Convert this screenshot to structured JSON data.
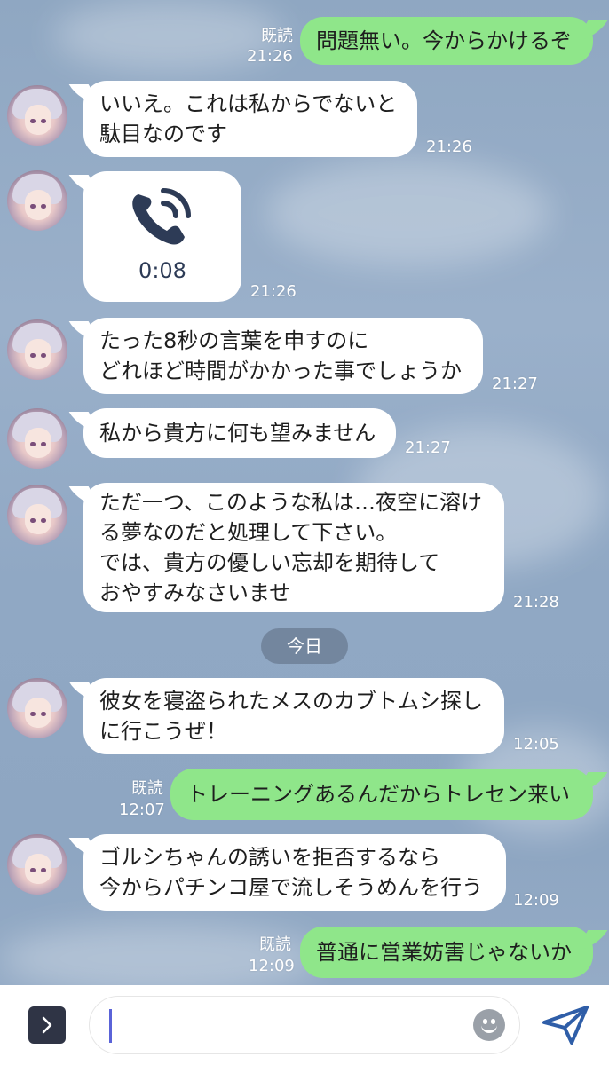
{
  "messages": [
    {
      "side": "out",
      "text": "問題無い。今からかけるぞ",
      "read": "既読",
      "time": "21:26"
    },
    {
      "side": "in",
      "text": "いいえ。これは私からでないと\n駄目なのです",
      "time": "21:26"
    },
    {
      "side": "in",
      "type": "call",
      "duration": "0:08",
      "time": "21:26"
    },
    {
      "side": "in",
      "text": "たった8秒の言葉を申すのに\nどれほど時間がかかった事でしょうか",
      "time": "21:27"
    },
    {
      "side": "in",
      "text": "私から貴方に何も望みません",
      "time": "21:27"
    },
    {
      "side": "in",
      "text": "ただ一つ、このような私は…夜空に溶け\nる夢なのだと処理して下さい。\nでは、貴方の優しい忘却を期待して\nおやすみなさいませ",
      "time": "21:28"
    },
    {
      "side": "in",
      "text": "彼女を寝盗られたメスのカブトムシ探し\nに行こうぜ！",
      "time": "12:05"
    },
    {
      "side": "out",
      "text": "トレーニングあるんだからトレセン来い",
      "read": "既読",
      "time": "12:07"
    },
    {
      "side": "in",
      "text": "ゴルシちゃんの誘いを拒否するなら\n今からパチンコ屋で流しそうめんを行う",
      "time": "12:09"
    },
    {
      "side": "out",
      "text": "普通に営業妨害じゃないか",
      "read": "既読",
      "time": "12:09"
    }
  ],
  "date_separator": "今日",
  "input": {
    "value": ""
  },
  "icons": {
    "expand": "chevron-right-icon",
    "emoji": "emoji-icon",
    "send": "send-icon",
    "call": "phone-call-icon",
    "avatar": "avatar"
  },
  "colors": {
    "outgoing_bubble": "#8fe68a",
    "incoming_bubble": "#ffffff",
    "date_pill": "#6e8098"
  }
}
